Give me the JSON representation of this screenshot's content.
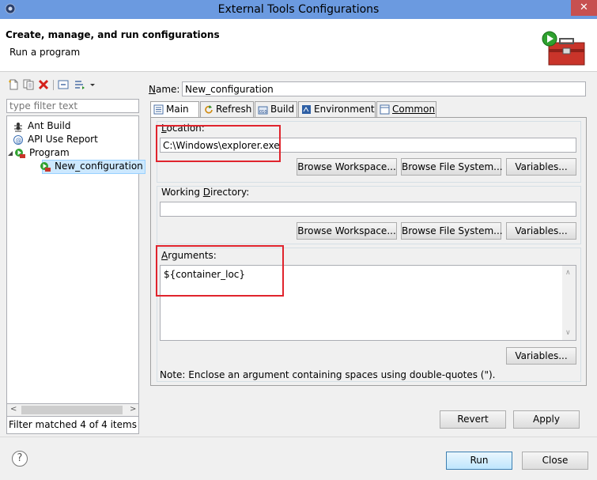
{
  "window": {
    "title": "External Tools Configurations",
    "close_glyph": "✕"
  },
  "header": {
    "title": "Create, manage, and run configurations",
    "subtitle": "Run a program"
  },
  "left": {
    "toolbar": [
      "new-config-icon",
      "duplicate-icon",
      "delete-icon",
      "collapse-all-icon",
      "filter-icon"
    ],
    "filter_placeholder": "type filter text",
    "tree": [
      {
        "label": "Ant Build",
        "icon": "ant-icon",
        "level": 1
      },
      {
        "label": "API Use Report",
        "icon": "api-report-icon",
        "level": 1
      },
      {
        "label": "Program",
        "icon": "program-icon",
        "level": 1,
        "expanded": true
      },
      {
        "label": "New_configuration",
        "icon": "program-config-icon",
        "level": 2,
        "selected": true
      }
    ],
    "status": "Filter matched 4 of 4 items"
  },
  "name": {
    "label_u": "N",
    "label_rest": "ame:",
    "value": "New_configuration"
  },
  "tabs": [
    {
      "label": "Main",
      "icon": "main-tab-icon",
      "active": true
    },
    {
      "label": "Refresh",
      "icon": "refresh-icon"
    },
    {
      "label": "Build",
      "icon": "build-icon"
    },
    {
      "label": "Environment",
      "icon": "environment-icon"
    },
    {
      "label": "Common",
      "icon": "common-icon"
    }
  ],
  "location": {
    "label_u": "L",
    "label_rest": "ocation:",
    "value": "C:\\Windows\\explorer.exe",
    "buttons": [
      "Browse Workspace...",
      "Browse File System...",
      "Variables..."
    ]
  },
  "working_dir": {
    "label_pre": "Working ",
    "label_u": "D",
    "label_rest": "irectory:",
    "value": "",
    "buttons": [
      "Browse Workspace...",
      "Browse File System...",
      "Variables..."
    ]
  },
  "arguments": {
    "label_u": "A",
    "label_rest": "rguments:",
    "value": "${container_loc}",
    "variables_button": "Variables...",
    "note": "Note: Enclose an argument containing spaces using double-quotes (\")."
  },
  "actions": {
    "revert": "Revert",
    "apply": "Apply",
    "run": "Run",
    "close": "Close",
    "help": "?"
  },
  "colors": {
    "title_bar": "#6b9ae0",
    "highlight": "#e0242d",
    "selection": "#cce8ff"
  }
}
